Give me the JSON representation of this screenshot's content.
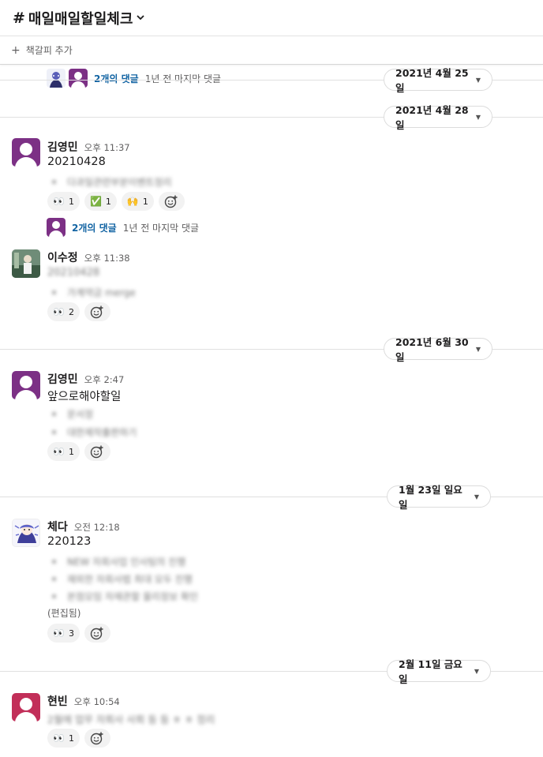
{
  "header": {
    "hash": "#",
    "channel": "매일매일할일체크"
  },
  "bookmarks": {
    "add_label": "책갈피 추가"
  },
  "thread_top": {
    "count": "2개의 댓글",
    "last": "1년 전 마지막 댓글"
  },
  "dates": {
    "d1": "2021년 4월 25일",
    "d2": "2021년 4월 28일",
    "d3": "2021년 6월 30일",
    "d4": "1월 23일 일요일",
    "d5": "2월 11일 금요일"
  },
  "messages": [
    {
      "name": "김영민",
      "time": "오후 11:37",
      "text": "20210428",
      "bullets": [
        "다과일관련부분이벤트정리"
      ],
      "reactions": [
        {
          "emoji": "👀",
          "count": "1"
        },
        {
          "emoji": "✅",
          "count": "1"
        },
        {
          "emoji": "🙌",
          "count": "1"
        }
      ],
      "thread": {
        "count": "2개의 댓글",
        "last": "1년 전 마지막 댓글"
      }
    },
    {
      "name": "이수정",
      "time": "오후 11:38",
      "text": "20210428",
      "bullets": [
        "가계약금 merge"
      ],
      "reactions": [
        {
          "emoji": "👀",
          "count": "2"
        }
      ]
    },
    {
      "name": "김영민",
      "time": "오후 2:47",
      "text": "앞으로해야할일",
      "bullets": [
        "문서정",
        "대한제작출판하기"
      ],
      "reactions": [
        {
          "emoji": "👀",
          "count": "1"
        }
      ]
    },
    {
      "name": "체다",
      "time": "오전 12:18",
      "text": "220123",
      "bullets": [
        "NEW 자회사업 인사팀의 진행",
        "재외한 자회사법 최대 모두 진행",
        "본점모임 자재관할 물리정보 확인"
      ],
      "edited": "(편집됨)",
      "reactions": [
        {
          "emoji": "👀",
          "count": "3"
        }
      ]
    },
    {
      "name": "현빈",
      "time": "오후 10:54",
      "text": "2월에 업무 자회사 사회 등 등 ㅎ ㅎ 정리",
      "reactions": [
        {
          "emoji": "👀",
          "count": "1"
        }
      ]
    }
  ]
}
